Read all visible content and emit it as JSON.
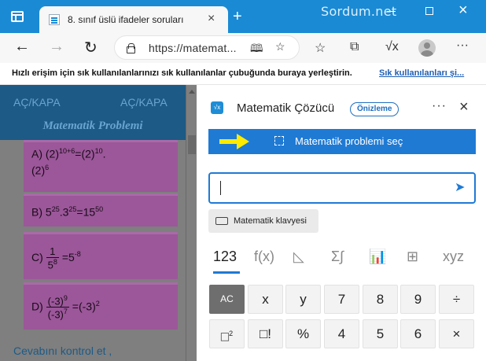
{
  "titlebar": {
    "tab_title": "8. sınıf üslü ifadeler soruları",
    "tab_close": "×",
    "new_tab": "+",
    "brand": "Sordum.net",
    "close": "×"
  },
  "toolbar": {
    "back": "←",
    "forward": "→",
    "refresh": "↻",
    "url": "https://matemat...",
    "more": "···"
  },
  "favorites": {
    "hint": "Hızlı erişim için sık kullanılanlarınızı sık kullanılanlar çubuğunda buraya yerleştirin.",
    "link": "Sık kullanılanları şi..."
  },
  "page": {
    "toggle_left": "AÇ/KAPA",
    "toggle_right": "AÇ/KAPA",
    "title": "Matematik Problemi",
    "questions": {
      "a": {
        "prefix": "A) (2)",
        "sup1": "10+6",
        "mid": "=(2)",
        "sup2": "10",
        "dot": ".",
        "line2": "(2)",
        "sup3": "6"
      },
      "b": {
        "prefix": "B) 5",
        "sup1": "25",
        "mid": ".3",
        "sup2": "25",
        "eq": "=15",
        "sup3": "50"
      },
      "c": {
        "prefix": "C)",
        "num": "1",
        "den": "5",
        "den_sup": "8",
        "eq": "=5",
        "eq_sup": "-8"
      },
      "d": {
        "prefix": "D)",
        "num": "(-3)",
        "num_sup": "9",
        "den": "(-3)",
        "den_sup": "7",
        "eq": "=(-3)",
        "eq_sup": "2"
      }
    },
    "answer_link": "Cevabını kontrol et ,"
  },
  "panel": {
    "title": "Matematik Çözücü",
    "badge": "Önizleme",
    "more": "···",
    "close": "×",
    "select_label": "Matematik problemi seç",
    "keyboard_label": "Matematik klavyesi",
    "tabs": [
      "123",
      "f(x)",
      "◺",
      "Σ∫",
      "📊",
      "⊞",
      "xyz"
    ],
    "keys": {
      "ac": "AC",
      "x": "x",
      "y": "y",
      "k7": "7",
      "k8": "8",
      "k9": "9",
      "div": "÷",
      "sq_base": "□",
      "sq_sup": "2",
      "fact": "□!",
      "pct": "%",
      "k4": "4",
      "k5": "5",
      "k6": "6",
      "mul": "×"
    }
  },
  "colors": {
    "titlebar": "#1a8ad4",
    "accent": "#1f7ad4",
    "question_bg": "#9b5799",
    "page_overlay": "#7f7f7f"
  }
}
